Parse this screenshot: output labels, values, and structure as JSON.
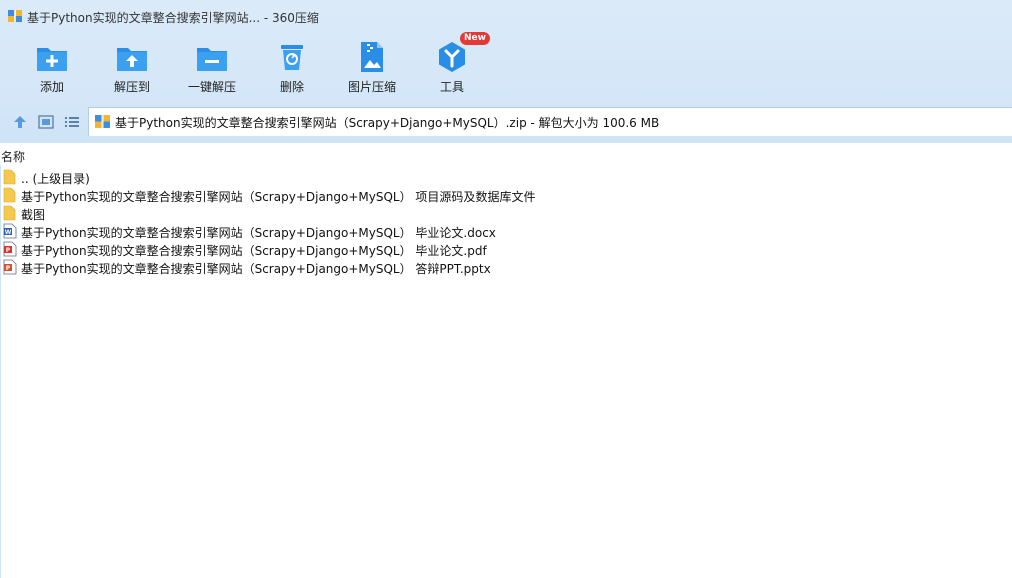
{
  "window": {
    "title": "基于Python实现的文章整合搜索引擎网站... - 360压缩"
  },
  "toolbar": {
    "buttons": [
      {
        "label": "添加",
        "icon": "add-icon"
      },
      {
        "label": "解压到",
        "icon": "extract-to-icon"
      },
      {
        "label": "一键解压",
        "icon": "one-click-extract-icon"
      },
      {
        "label": "删除",
        "icon": "delete-icon"
      },
      {
        "label": "图片压缩",
        "icon": "image-compress-icon"
      },
      {
        "label": "工具",
        "icon": "tools-icon",
        "badge": "New"
      }
    ]
  },
  "nav": {
    "path": "基于Python实现的文章整合搜索引擎网站（Scrapy+Django+MySQL）.zip - 解包大小为 100.6 MB"
  },
  "list": {
    "column_name": "名称",
    "items": [
      {
        "name": ".. (上级目录)",
        "type": "folder",
        "icon": "folder-icon"
      },
      {
        "name": "基于Python实现的文章整合搜索引擎网站（Scrapy+Django+MySQL） 项目源码及数据库文件",
        "type": "folder",
        "icon": "folder-icon"
      },
      {
        "name": "截图",
        "type": "folder",
        "icon": "folder-icon"
      },
      {
        "name": "基于Python实现的文章整合搜索引擎网站（Scrapy+Django+MySQL） 毕业论文.docx",
        "type": "docx",
        "icon": "word-file-icon"
      },
      {
        "name": "基于Python实现的文章整合搜索引擎网站（Scrapy+Django+MySQL） 毕业论文.pdf",
        "type": "pdf",
        "icon": "pdf-file-icon"
      },
      {
        "name": "基于Python实现的文章整合搜索引擎网站（Scrapy+Django+MySQL） 答辩PPT.pptx",
        "type": "pptx",
        "icon": "ppt-file-icon"
      }
    ]
  },
  "colors": {
    "accent": "#2a8ee6",
    "header_bg": "#d6e8f8",
    "badge": "#e53935"
  }
}
